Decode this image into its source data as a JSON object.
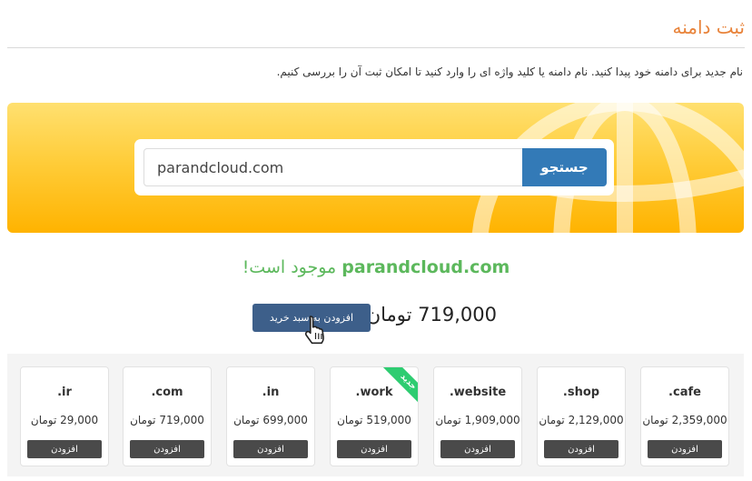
{
  "page": {
    "title": "ثبت دامنه",
    "intro": "نام جدید برای دامنه خود پیدا کنید. نام دامنه یا کلید واژه ای را وارد کنید تا امکان ثبت آن را بررسی کنیم."
  },
  "search": {
    "value": "parandcloud.com",
    "button_label": "جستجو"
  },
  "result": {
    "domain": "parandcloud.com",
    "status": "موجود است!",
    "price_text": "719,000 تومان",
    "add_to_cart_label": "افزودن به سبد خرید"
  },
  "tlds": [
    {
      "name": ".ir",
      "price": "29,000 تومان",
      "add_label": "افزودن"
    },
    {
      "name": ".com",
      "price": "719,000 تومان",
      "add_label": "افزودن"
    },
    {
      "name": ".in",
      "price": "699,000 تومان",
      "add_label": "افزودن"
    },
    {
      "name": ".work",
      "price": "519,000 تومان",
      "add_label": "افزودن",
      "badge": "جدید"
    },
    {
      "name": ".website",
      "price": "1,909,000 تومان",
      "add_label": "افزودن"
    },
    {
      "name": ".shop",
      "price": "2,129,000 تومان",
      "add_label": "افزودن"
    },
    {
      "name": ".cafe",
      "price": "2,359,000 تومان",
      "add_label": "افزودن"
    }
  ],
  "colors": {
    "accent_orange": "#e8833a",
    "available_green": "#5cb85c",
    "search_button": "#337ab7",
    "cart_button": "#3d5f8a",
    "banner_yellow": "#ffc629",
    "badge_green": "#2ecc71"
  },
  "icons": {
    "banner_globe": "globe-icon",
    "cursor": "hand-pointer-icon"
  }
}
